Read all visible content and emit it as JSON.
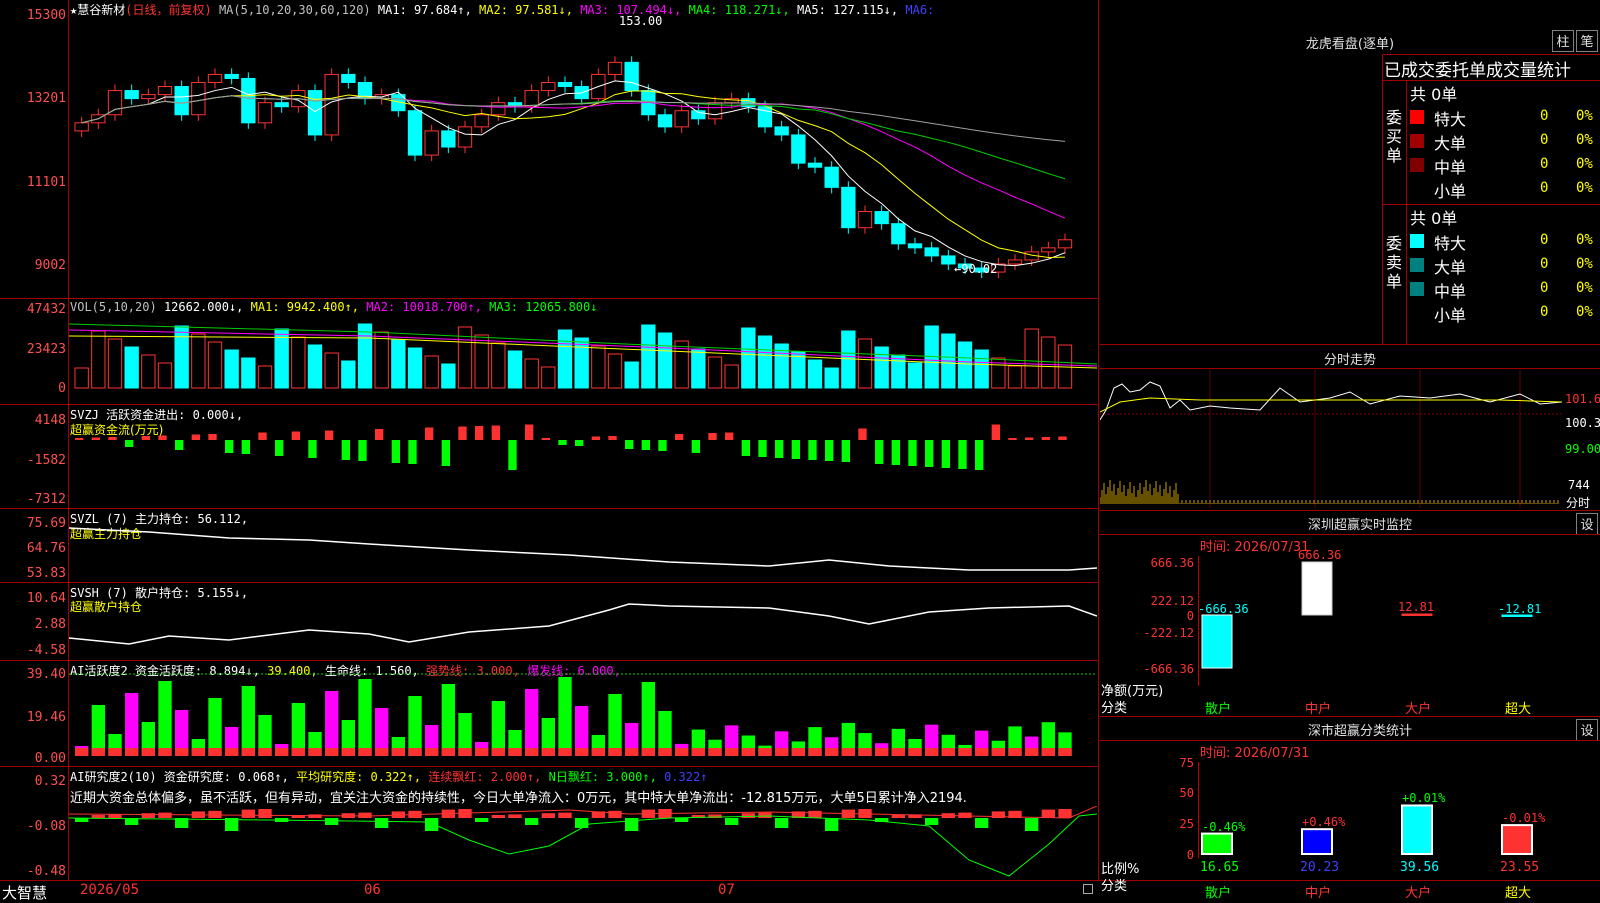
{
  "stock": {
    "star": "★",
    "name": "慧谷新材",
    "mode": "(日线，前复权)"
  },
  "ma_header": {
    "label": "MA(5,10,20,30,60,120)",
    "ma1": "MA1: 97.684↑,",
    "ma2": "MA2: 97.581↓,",
    "ma3": "MA3: 107.494↓,",
    "ma4": "MA4: 118.271↓,",
    "ma5": "MA5: 127.115↓,",
    "ma6": "MA6:"
  },
  "price_axis": [
    "15300",
    "13201",
    "11101",
    "9002"
  ],
  "price_marks": {
    "high": "153.00",
    "low": "←90.02"
  },
  "vol": {
    "label": "VOL(5,10,20)",
    "val": "12662.000↓,",
    "ma1": "MA1: 9942.400↑,",
    "ma2": "MA2: 10018.700↑,",
    "ma3": "MA3: 12065.800↓",
    "axis": [
      "47432",
      "23423",
      "0"
    ]
  },
  "svzj": {
    "label": "SVZJ  活跃资金进出: 0.000↓,",
    "sub": "超赢资金流(万元)",
    "axis": [
      "4148",
      "-1582",
      "-7312"
    ]
  },
  "svzl": {
    "label": "SVZL (7) 主力持仓: 56.112,",
    "sub": "超赢主力持仓",
    "axis": [
      "75.69",
      "64.76",
      "53.83"
    ]
  },
  "svsh": {
    "label": "SVSH (7) 散户持仓: 5.155↓,",
    "sub": "超赢散户持仓",
    "axis": [
      "10.64",
      "2.88",
      "-4.58"
    ]
  },
  "ai2": {
    "label": "AI活跃度2 资金活跃度: 8.894↓,",
    "v1": "39.400,",
    "v2": "生命线: 1.560,",
    "v3": "强势线: 3.000,",
    "v4": "爆发线: 6.000,",
    "axis": [
      "39.40",
      "19.46",
      "0.00"
    ]
  },
  "ai_res": {
    "label": "AI研究度2(10) 资金研究度: 0.068↑,",
    "v1": "平均研究度: 0.322↑,",
    "v2": "连续飘红: 2.000↑,",
    "v3": "N日飘红: 3.000↑,",
    "v4": "0.322↑",
    "comment": "近期大资金总体偏多，虽不活跃，但有异动，宜关注大资金的持续性，今日大单净流入：0万元，其中特大单净流出：-12.815万元，大单5日累计净入2194.",
    "axis": [
      "0.32",
      "-0.08",
      "-0.48"
    ]
  },
  "bottom": {
    "brand": "大智慧",
    "d1": "2026/05",
    "d2": "06",
    "d3": "07"
  },
  "lhb": {
    "title": "龙虎看盘(逐单)",
    "btn1": "柱",
    "btn2": "笔",
    "header": "已成交委托单成交量统计",
    "buy": "委买单",
    "sell": "委卖单",
    "total": "共 0单",
    "rows": [
      {
        "n": "特大",
        "v": "0",
        "p": "0%"
      },
      {
        "n": "大单",
        "v": "0",
        "p": "0%"
      },
      {
        "n": "中单",
        "v": "0",
        "p": "0%"
      },
      {
        "n": "小单",
        "v": "0",
        "p": "0%"
      }
    ]
  },
  "fs": {
    "title": "分时走势",
    "axis": [
      "101.6",
      "100.3",
      "99.00"
    ],
    "vol": "744",
    "unit": "分时"
  },
  "sz": {
    "title": "深圳超赢实时监控",
    "btn": "设",
    "time": "时间: 2026/07/31",
    "axis": [
      "666.36",
      "222.12",
      "0",
      "-222.12",
      "-666.36"
    ],
    "ylab": "净额(万元)",
    "xlab": "分类",
    "cats": [
      "散户",
      "中户",
      "大户",
      "超大"
    ],
    "vals": [
      "-666.36",
      "666.36",
      "12.81",
      "-12.81"
    ]
  },
  "sc": {
    "title": "深市超赢分类统计",
    "btn": "设",
    "time": "时间: 2026/07/31",
    "axis": [
      "75",
      "50",
      "25",
      "0"
    ],
    "ylab": "比例%",
    "xlab": "分类",
    "cats": [
      "散户",
      "中户",
      "大户",
      "超大"
    ],
    "vals": [
      "16.65",
      "20.23",
      "39.56",
      "23.55"
    ],
    "chg": [
      "-0.46%",
      "+0.46%",
      "+0.01%",
      "-0.01%"
    ]
  },
  "chart_data": {
    "type": "candlestick",
    "title": "慧谷新材 (日线，前复权)",
    "ylim": [
      90.02,
      153.0
    ],
    "x_labels": [
      "2026/05",
      "06",
      "07"
    ],
    "closes": [
      128,
      130,
      136,
      134,
      135,
      137,
      130,
      138,
      140,
      139,
      128,
      133,
      132,
      136,
      125,
      140,
      138,
      134,
      135,
      131,
      120,
      126,
      122,
      127,
      130,
      133,
      132,
      136,
      138,
      137,
      134,
      140,
      143,
      136,
      130,
      127,
      131,
      129,
      133,
      134,
      132,
      127,
      125,
      118,
      117,
      112,
      102,
      106,
      103,
      98,
      97,
      95,
      93,
      92,
      91,
      93,
      94,
      96,
      97,
      99
    ]
  }
}
